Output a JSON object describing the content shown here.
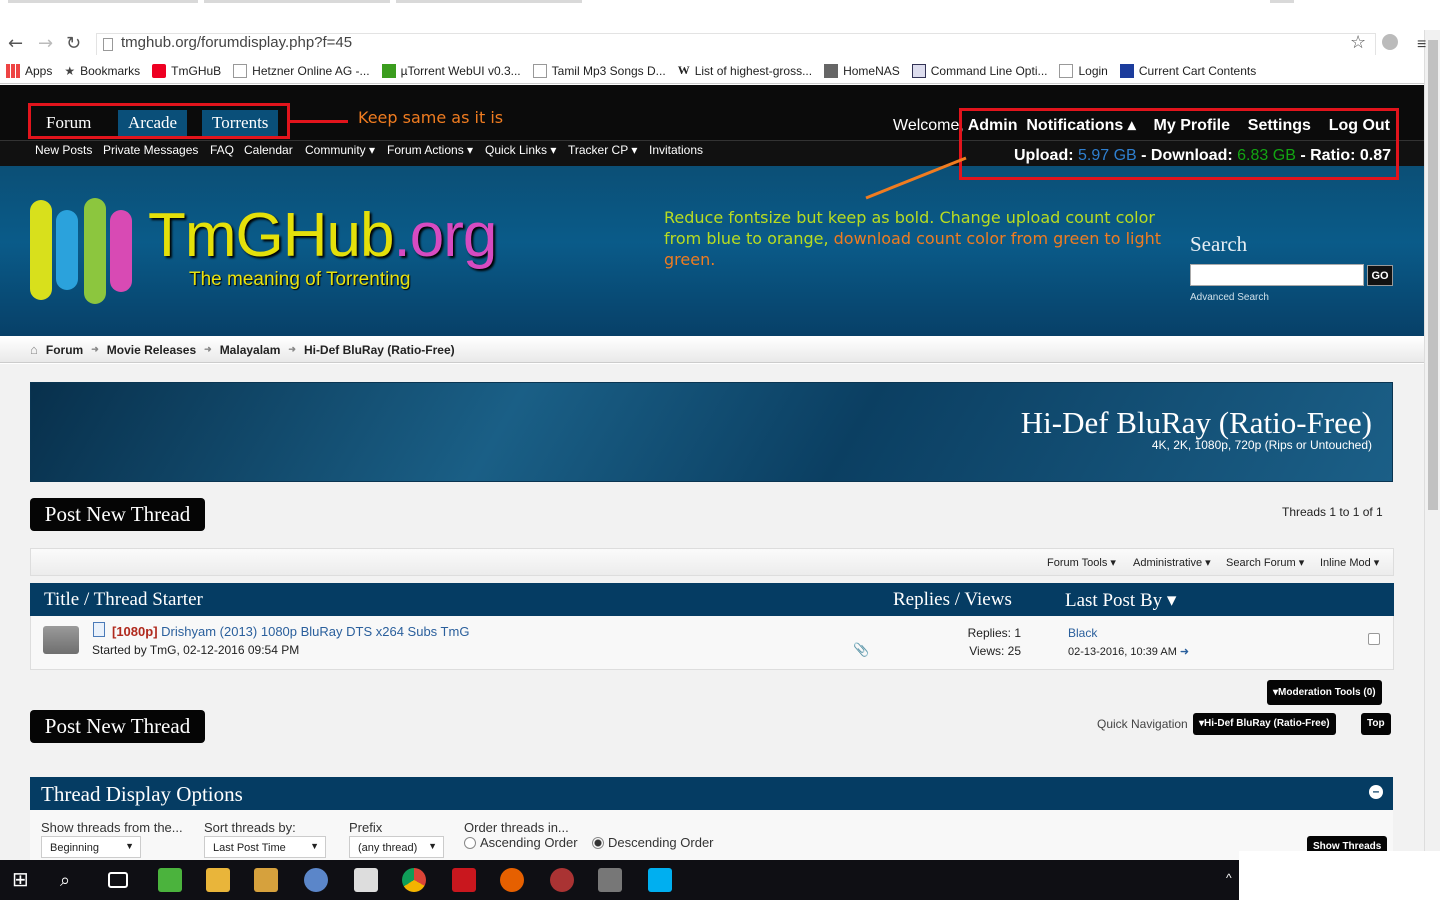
{
  "browser": {
    "url": "tmghub.org/forumdisplay.php?f=45",
    "bookmarks": [
      "Apps",
      "Bookmarks",
      "TmGHuB",
      "Hetzner Online AG -...",
      "µTorrent WebUI v0.3...",
      "Tamil Mp3 Songs D...",
      "List of highest-gross...",
      "HomeNAS",
      "Command Line Opti...",
      "Login",
      "Current Cart Contents"
    ]
  },
  "topnav": {
    "tabs": [
      "Forum",
      "Arcade",
      "Torrents"
    ],
    "subnav": [
      "New Posts",
      "Private Messages",
      "FAQ",
      "Calendar",
      "Community ▾",
      "Forum Actions ▾",
      "Quick Links ▾",
      "Tracker CP ▾",
      "Invitations"
    ],
    "welcome": "Welcome,",
    "user": "Admin",
    "links": [
      "Notifications ▴",
      "My Profile",
      "Settings",
      "Log Out"
    ],
    "stats": {
      "upload_label": "Upload:",
      "upload_value": "5.97 GB",
      "download_label": "- Download:",
      "download_value": "6.83 GB",
      "ratio": "- Ratio: 0.87"
    }
  },
  "annotations": {
    "keep": "Keep same as it is",
    "reduce_1": "Reduce fontsize but keep as bold. Change upload count color from blue to orange,",
    "reduce_2": "download count color from green to light green.",
    "colors": {
      "box": "#e2141c",
      "orange": "#f07c20",
      "green": "#b9dc20"
    }
  },
  "header": {
    "logo_main": "TmGHub",
    "logo_org": ".org",
    "tagline": "The meaning of Torrenting",
    "search_label": "Search",
    "search_go": "GO",
    "advanced_search": "Advanced Search"
  },
  "breadcrumb": [
    "Forum",
    "Movie Releases",
    "Malayalam",
    "Hi-Def BluRay (Ratio-Free)"
  ],
  "forum": {
    "title": "Hi-Def BluRay (Ratio-Free)",
    "description": "4K, 2K, 1080p, 720p (Rips or Untouched)",
    "post_new_thread": "Post New Thread",
    "thread_count": "Threads 1 to 1 of 1",
    "tools": [
      "Forum Tools ▾",
      "Administrative ▾",
      "Search Forum ▾",
      "Inline Mod ▾"
    ],
    "columns": [
      "Title / Thread Starter",
      "Replies / Views",
      "Last Post By ▾"
    ],
    "threads": [
      {
        "prefix": "[1080p]",
        "title": "Drishyam (2013) 1080p BluRay DTS x264 Subs TmG",
        "starter": "Started by TmG, 02-12-2016 09:54 PM",
        "replies": "Replies: 1",
        "views": "Views: 25",
        "last_post_user": "Black",
        "last_post_date": "02-13-2016, 10:39 AM"
      }
    ],
    "moderation_tools": "Moderation Tools (0)",
    "quick_nav_label": "Quick Navigation",
    "quick_nav_value": "Hi-Def BluRay (Ratio-Free)",
    "top": "Top"
  },
  "display_options": {
    "title": "Thread Display Options",
    "toggle": "–",
    "show_from_label": "Show threads from the...",
    "show_from_value": "Beginning",
    "sort_label": "Sort threads by:",
    "sort_value": "Last Post Time",
    "prefix_label": "Prefix",
    "prefix_value": "(any thread)",
    "order_label": "Order threads in...",
    "asc": "Ascending Order",
    "desc": "Descending Order",
    "show_threads": "Show Threads"
  }
}
